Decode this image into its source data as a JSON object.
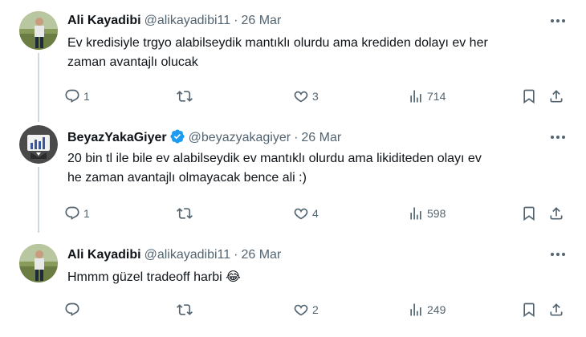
{
  "tweets": [
    {
      "name": "Ali Kayadibi",
      "handle": "@alikayadibi11",
      "separator": "·",
      "date": "26 Mar",
      "lines": [
        "Ev kredisiyle trgyo alabilseydik mantıklı olurdu ama krediden dolayı ev her",
        "zaman avantajlı olucak"
      ],
      "replies": "1",
      "retweets": "",
      "likes": "3",
      "views": "714",
      "verified": false
    },
    {
      "name": "BeyazYakaGiyer",
      "handle": "@beyazyakagiyer",
      "separator": "·",
      "date": "26 Mar",
      "lines": [
        "20 bin tl ile bile ev alabilseydik ev mantıklı olurdu ama likiditeden olayı ev",
        "he zaman avantajlı olmayacak bence ali :)"
      ],
      "replies": "1",
      "retweets": "",
      "likes": "4",
      "views": "598",
      "verified": true
    },
    {
      "name": "Ali Kayadibi",
      "handle": "@alikayadibi11",
      "separator": "·",
      "date": "26 Mar",
      "lines": [
        "Hmmm güzel tradeoff harbi 😂"
      ],
      "replies": "",
      "retweets": "",
      "likes": "2",
      "views": "249",
      "verified": false
    }
  ],
  "colors": {
    "text": "#0f1419",
    "secondary": "#536471",
    "verified": "#1d9bf0",
    "thread_line": "#cfd9de"
  }
}
